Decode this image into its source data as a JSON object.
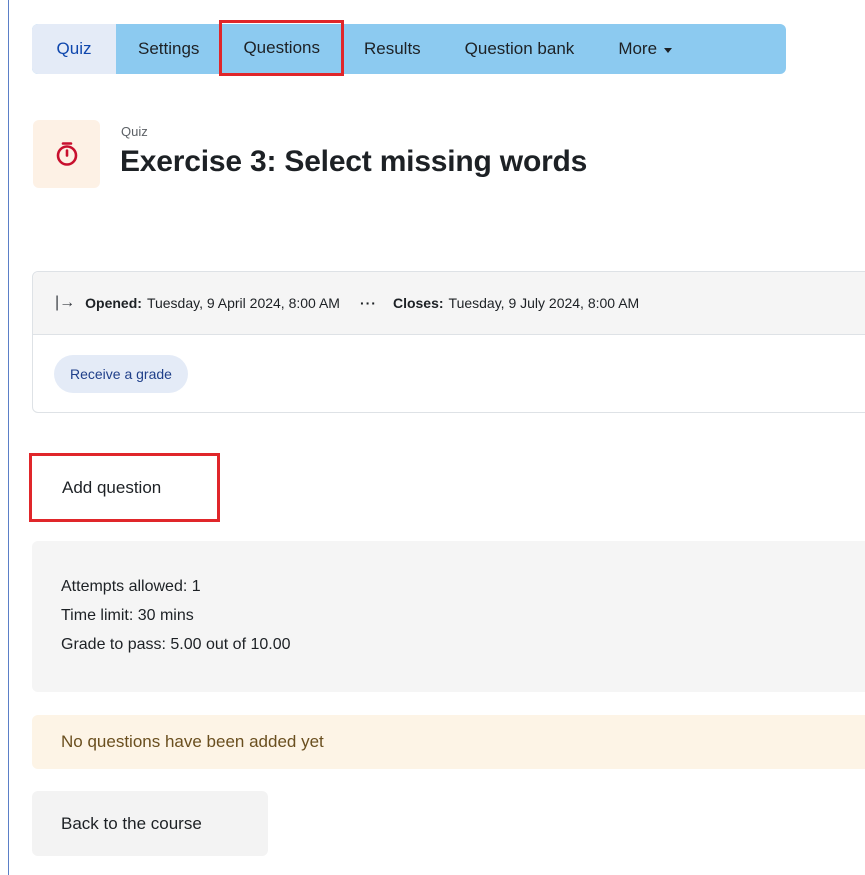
{
  "nav": {
    "tabs": [
      {
        "label": "Quiz"
      },
      {
        "label": "Settings"
      },
      {
        "label": "Questions"
      },
      {
        "label": "Results"
      },
      {
        "label": "Question bank"
      },
      {
        "label": "More"
      }
    ],
    "active_tab": "Quiz",
    "highlighted_tab": "Questions"
  },
  "header": {
    "pre_title": "Quiz",
    "title": "Exercise 3: Select missing words",
    "icon": "stopwatch-icon"
  },
  "dates": {
    "opened_label": "Opened:",
    "opened_value": "Tuesday, 9 April 2024, 8:00 AM",
    "separator": "···",
    "closes_label": "Closes:",
    "closes_value": "Tuesday, 9 July 2024, 8:00 AM"
  },
  "completion": {
    "badge": "Receive a grade"
  },
  "actions": {
    "add_question": "Add question",
    "back": "Back to the course"
  },
  "info": {
    "attempts": "Attempts allowed: 1",
    "time_limit": "Time limit: 30 mins",
    "grade_to_pass": "Grade to pass: 5.00 out of 10.00"
  },
  "notice": {
    "text": "No questions have been added yet"
  },
  "colors": {
    "tab_bar": "#8ccaf0",
    "highlight": "#e0262a",
    "icon_accent": "#c8102e"
  }
}
